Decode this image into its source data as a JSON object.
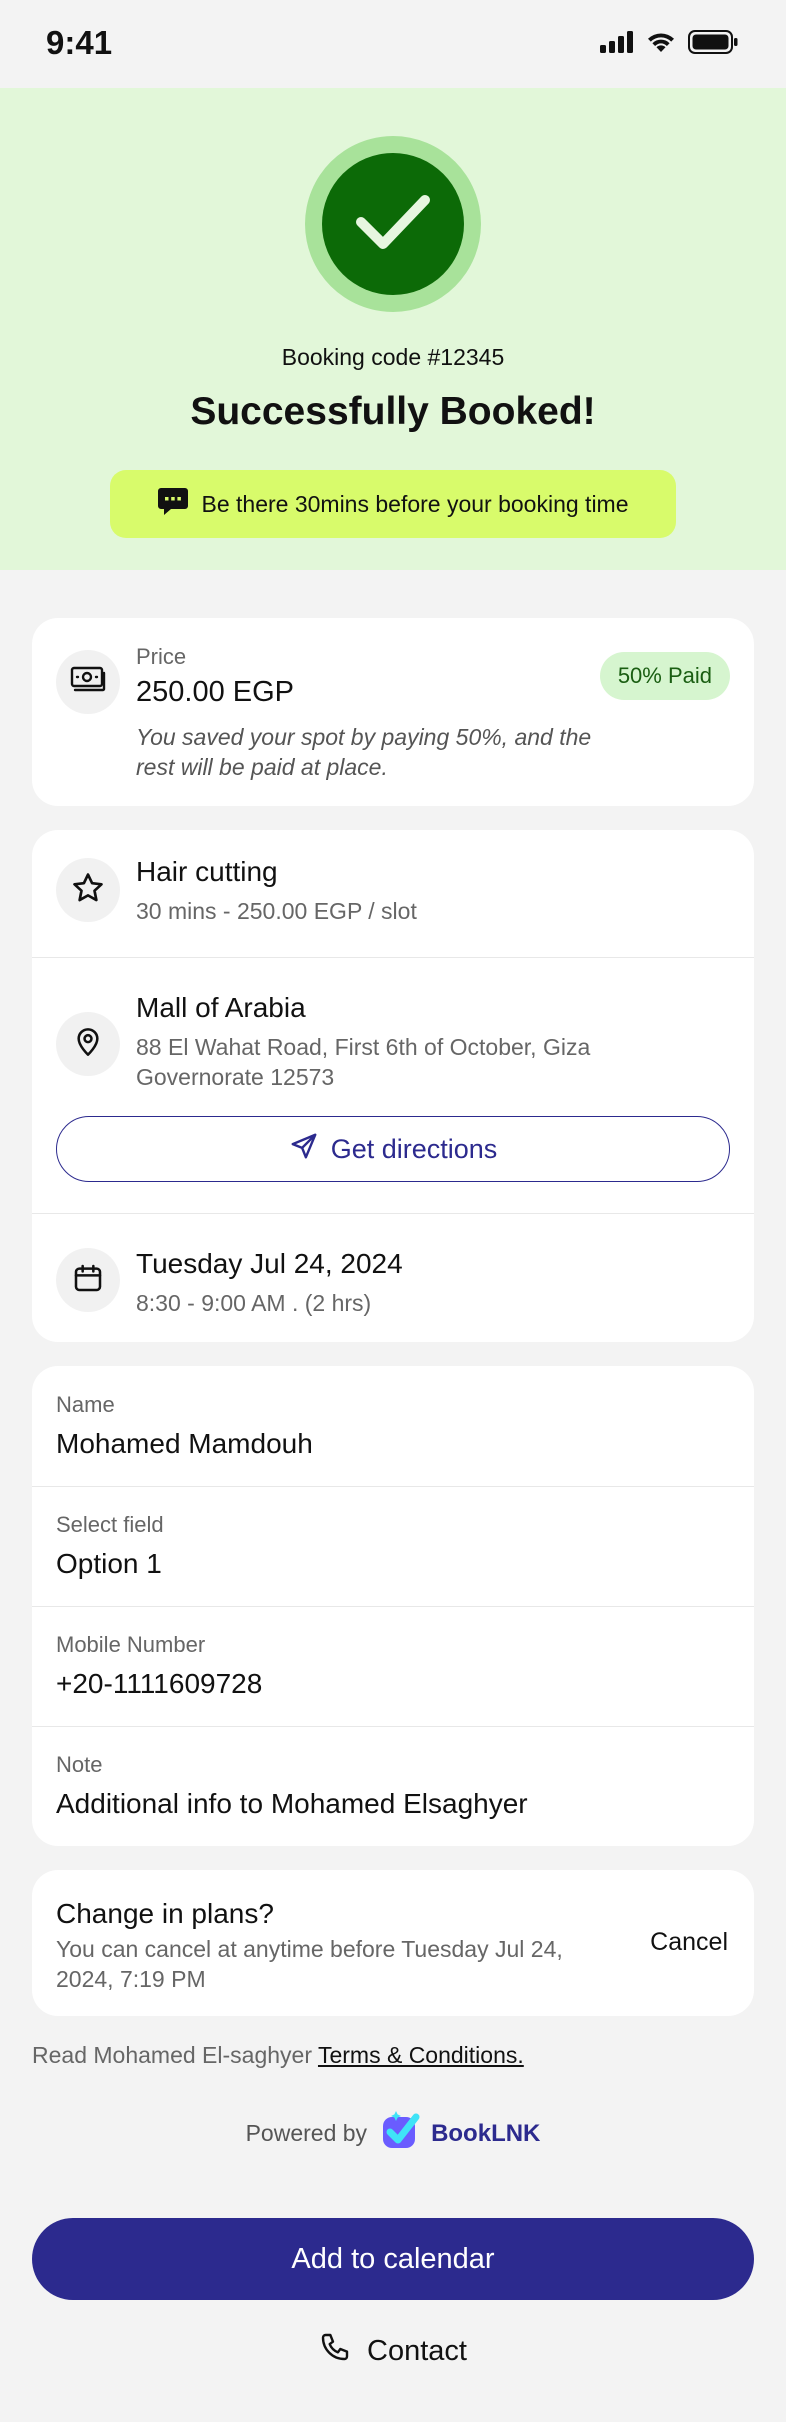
{
  "status_bar": {
    "time": "9:41"
  },
  "hero": {
    "booking_code": "Booking code #12345",
    "title": "Successfully Booked!",
    "notice": "Be there 30mins before your booking time"
  },
  "price": {
    "label": "Price",
    "value": "250.00 EGP",
    "badge": "50% Paid",
    "note": "You saved your spot by paying 50%, and the rest will be paid at place."
  },
  "service": {
    "name": "Hair cutting",
    "details": "30 mins - 250.00 EGP / slot"
  },
  "location": {
    "name": "Mall of Arabia",
    "address": "88 El Wahat Road, First 6th of October, Giza Governorate 12573",
    "directions_label": "Get directions"
  },
  "schedule": {
    "date": "Tuesday Jul 24, 2024",
    "time": "8:30 - 9:00 AM . (2 hrs)"
  },
  "form_fields": [
    {
      "label": "Name",
      "value": "Mohamed Mamdouh"
    },
    {
      "label": "Select field",
      "value": "Option 1"
    },
    {
      "label": "Mobile Number",
      "value": "+20-1111609728"
    },
    {
      "label": "Note",
      "value": "Additional info to Mohamed Elsaghyer"
    }
  ],
  "plans": {
    "title": "Change in plans?",
    "text": "You can cancel at anytime before Tuesday Jul 24, 2024, 7:19 PM",
    "cancel_label": "Cancel"
  },
  "terms": {
    "prefix": "Read Mohamed El-saghyer",
    "link": "Terms & Conditions."
  },
  "powered": {
    "prefix": "Powered by",
    "brand": "BookLNK"
  },
  "actions": {
    "add_calendar": "Add to calendar",
    "contact": "Contact"
  },
  "colors": {
    "primary": "#2c2a8e",
    "hero_bg": "#e2f7d9",
    "check_dark": "#0c6a07",
    "check_light": "#a8e29a",
    "notice_bg": "#d8fb6b",
    "paid_badge_bg": "#d6f5cf"
  },
  "icons": {
    "status": [
      "signal-icon",
      "wifi-icon",
      "battery-icon"
    ],
    "hero": "checkmark-icon",
    "notice": "chat-bubble-icon",
    "price": "money-icon",
    "service": "star-icon",
    "location": "map-pin-icon",
    "directions": "navigation-arrow-icon",
    "schedule": "calendar-icon",
    "brand": "booklnk-logo",
    "contact": "phone-icon"
  }
}
